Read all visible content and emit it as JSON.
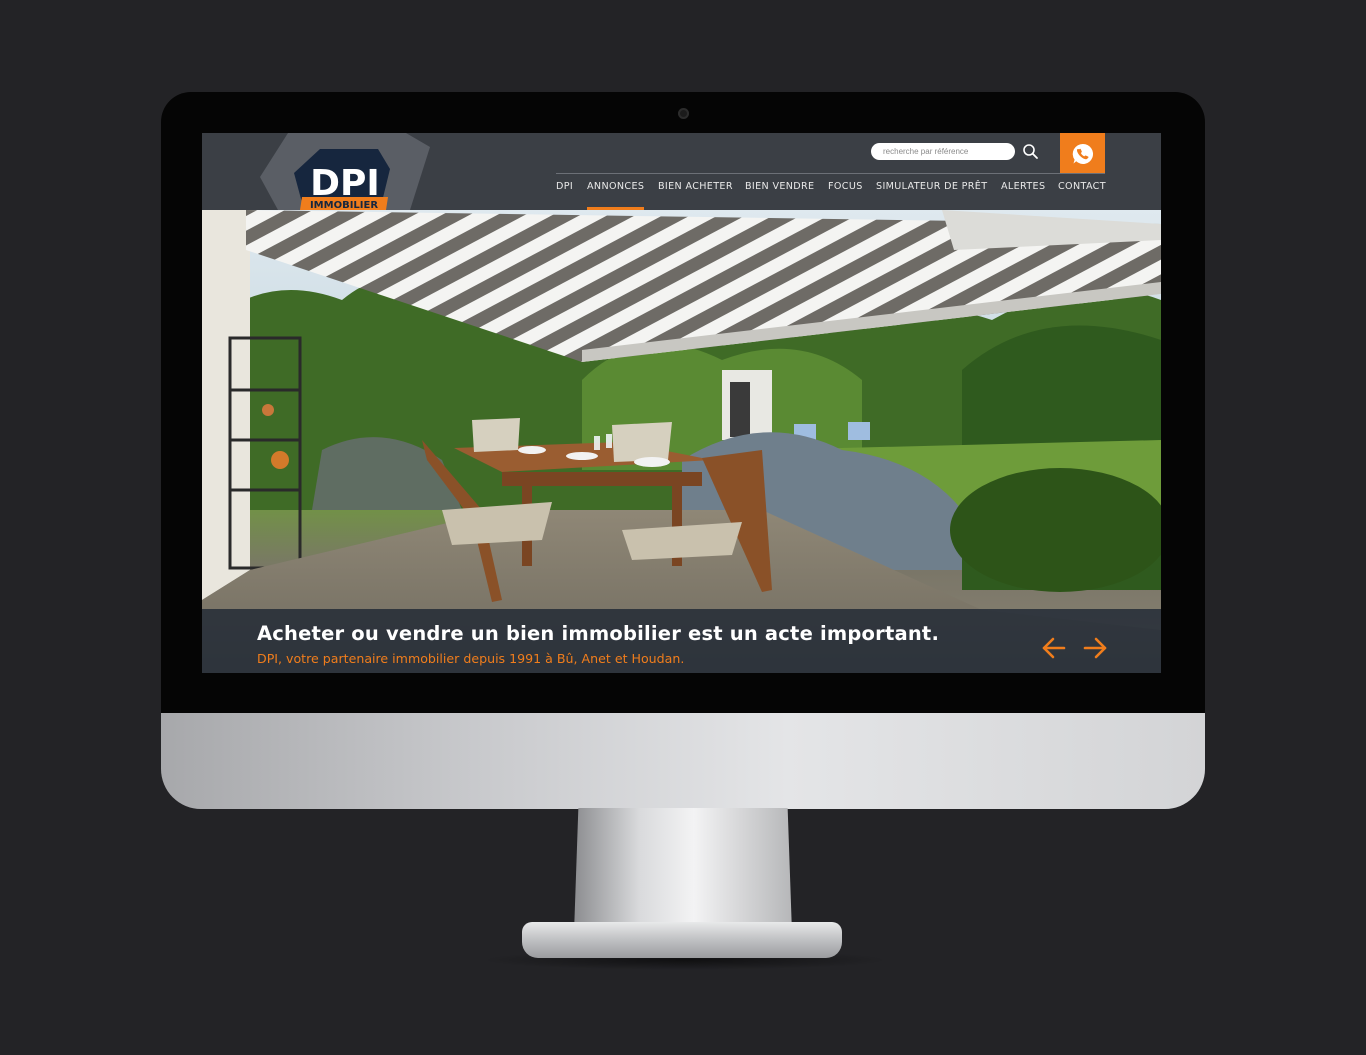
{
  "search": {
    "placeholder": "recherche par référence"
  },
  "icons": {
    "search": "search-icon",
    "phone": "phone-icon",
    "prev": "arrow-left-icon",
    "next": "arrow-right-icon"
  },
  "logo": {
    "brand": "DPI",
    "subtitle": "IMMOBILIER"
  },
  "nav": {
    "items": [
      {
        "label": "DPI",
        "active": false
      },
      {
        "label": "ANNONCES",
        "active": true
      },
      {
        "label": "BIEN ACHETER",
        "active": false
      },
      {
        "label": "BIEN VENDRE",
        "active": false
      },
      {
        "label": "FOCUS",
        "active": false
      },
      {
        "label": "SIMULATEUR DE PRÊT",
        "active": false
      },
      {
        "label": "ALERTES",
        "active": false
      },
      {
        "label": "CONTACT",
        "active": false
      }
    ]
  },
  "hero": {
    "title": "Acheter ou vendre un bien immobilier est un acte important.",
    "subtitle": "DPI, votre partenaire immobilier depuis 1991 à Bû, Anet et Houdan."
  },
  "colors": {
    "accent": "#f07d1c",
    "header_bg": "#3b3f45",
    "logo_navy": "#16263e"
  }
}
